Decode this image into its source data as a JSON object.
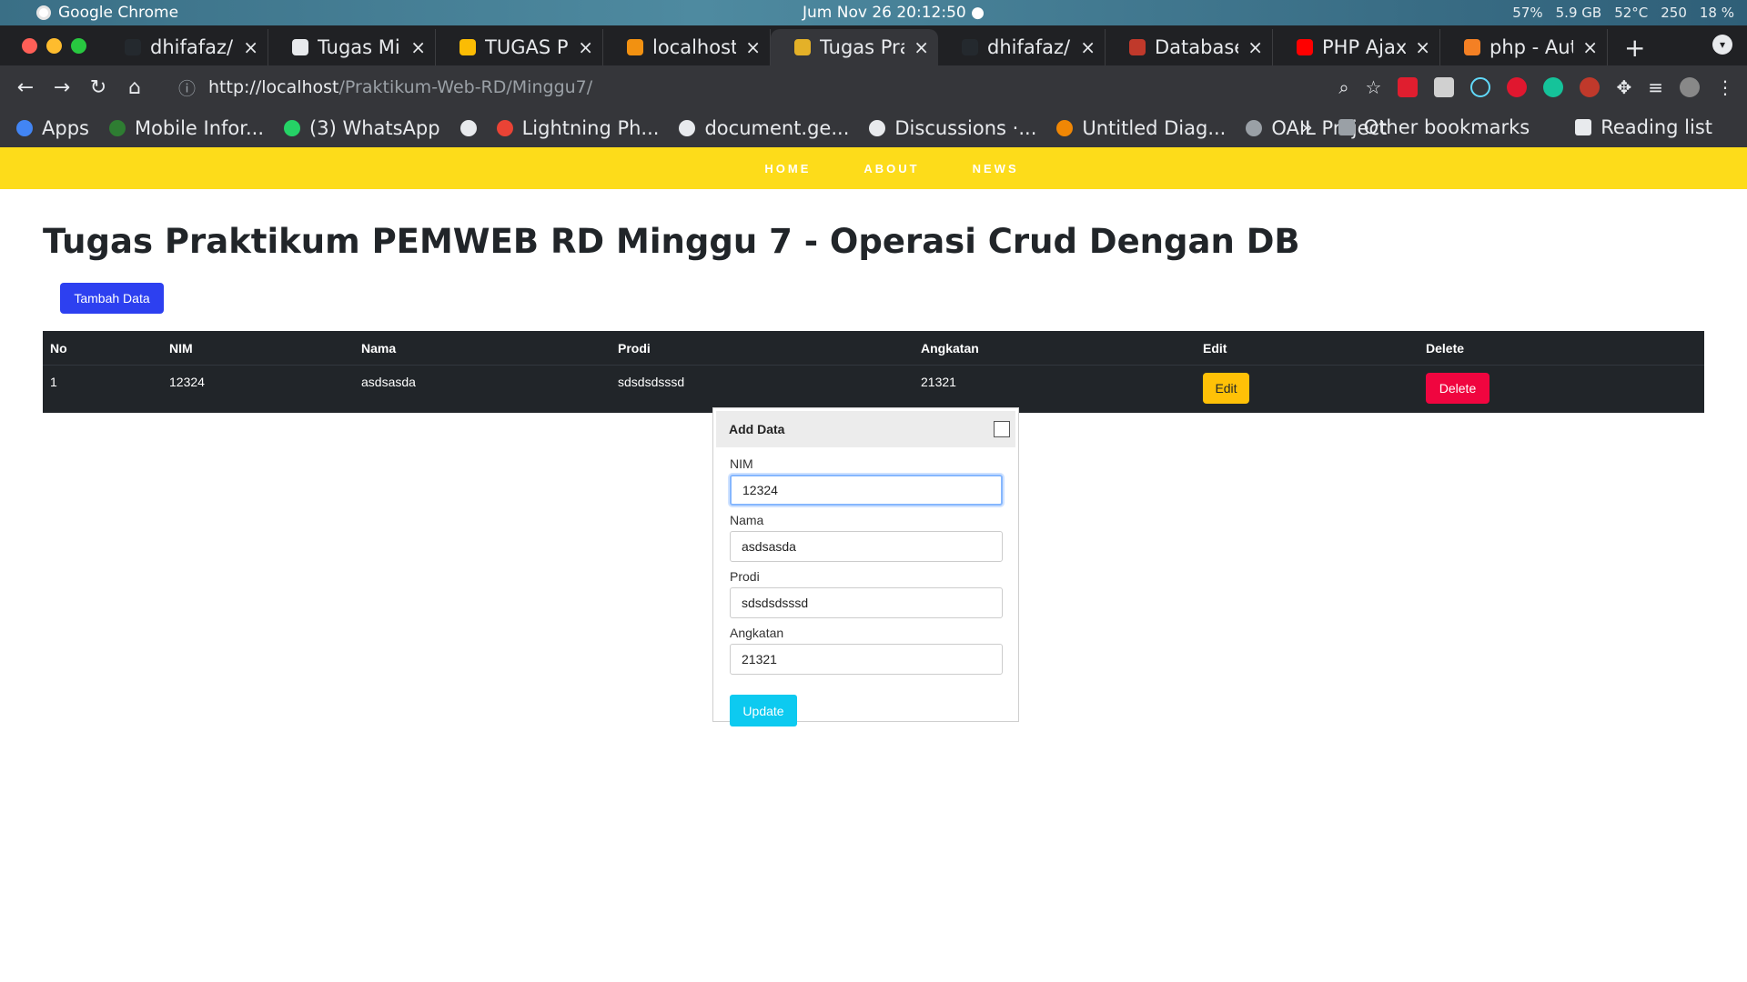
{
  "os": {
    "app_name": "Google Chrome",
    "clock": "Jum Nov 26  20:12:50  ●",
    "status": [
      "57%",
      "5.9 GB",
      "52°C",
      "250",
      "18 %"
    ]
  },
  "tabs": [
    {
      "title": "dhifafaz/Pr",
      "favicon_color": "#24292e",
      "active": false
    },
    {
      "title": "Tugas Ming",
      "favicon_color": "#e8eaed",
      "active": false
    },
    {
      "title": "TUGAS PRA",
      "favicon_color": "#fbbc04",
      "active": false
    },
    {
      "title": "localhost / ",
      "favicon_color": "#f29111",
      "active": false
    },
    {
      "title": "Tugas Prakt",
      "favicon_color": "#e4b128",
      "active": true
    },
    {
      "title": "dhifafaz/IF",
      "favicon_color": "#24292e",
      "active": false
    },
    {
      "title": "Database: ",
      "favicon_color": "#c0392b",
      "active": false
    },
    {
      "title": "PHP Ajax C",
      "favicon_color": "#ff0000",
      "active": false
    },
    {
      "title": "php - Auto ",
      "favicon_color": "#f48024",
      "active": false
    }
  ],
  "toolbar": {
    "url_host": "http://localhost",
    "url_path": "/Praktikum-Web-RD/Minggu7/"
  },
  "bookmarks": {
    "items": [
      {
        "label": "Apps",
        "icon_color": "#4285f4"
      },
      {
        "label": "Mobile Infor...",
        "icon_color": "#2e7d32"
      },
      {
        "label": "(3) WhatsApp",
        "icon_color": "#25d366"
      },
      {
        "label": "",
        "icon_color": "#e8eaed"
      },
      {
        "label": "Lightning Ph...",
        "icon_color": "#ea4335"
      },
      {
        "label": "document.ge...",
        "icon_color": "#e8eaed"
      },
      {
        "label": "Discussions ·...",
        "icon_color": "#e8eaed"
      },
      {
        "label": "Untitled Diag...",
        "icon_color": "#f08705"
      },
      {
        "label": "OAIL Project",
        "icon_color": "#9aa0a6"
      }
    ],
    "more": "»",
    "other": "Other bookmarks",
    "reading": "Reading list"
  },
  "site_nav": [
    "HOME",
    "ABOUT",
    "NEWS"
  ],
  "page": {
    "title": "Tugas Praktikum PEMWEB RD Minggu 7 - Operasi Crud Dengan DB",
    "add_button": "Tambah Data"
  },
  "table": {
    "headers": [
      "No",
      "NIM",
      "Nama",
      "Prodi",
      "Angkatan",
      "Edit",
      "Delete"
    ],
    "rows": [
      {
        "no": "1",
        "nim": "12324",
        "nama": "asdsasda",
        "prodi": "sdsdsdsssd",
        "angkatan": "21321",
        "edit": "Edit",
        "delete": "Delete"
      }
    ]
  },
  "modal": {
    "title": "Add Data",
    "fields": [
      {
        "label": "NIM",
        "value": "12324"
      },
      {
        "label": "Nama",
        "value": "asdsasda"
      },
      {
        "label": "Prodi",
        "value": "sdsdsdsssd"
      },
      {
        "label": "Angkatan",
        "value": "21321"
      }
    ],
    "submit": "Update"
  },
  "colors": {
    "nav_yellow": "#fddc1a",
    "add_blue": "#2d40f0",
    "edit_yellow": "#ffc107",
    "delete_red": "#f0053f",
    "update_cyan": "#0dcaf0",
    "table_dark": "#212529"
  }
}
